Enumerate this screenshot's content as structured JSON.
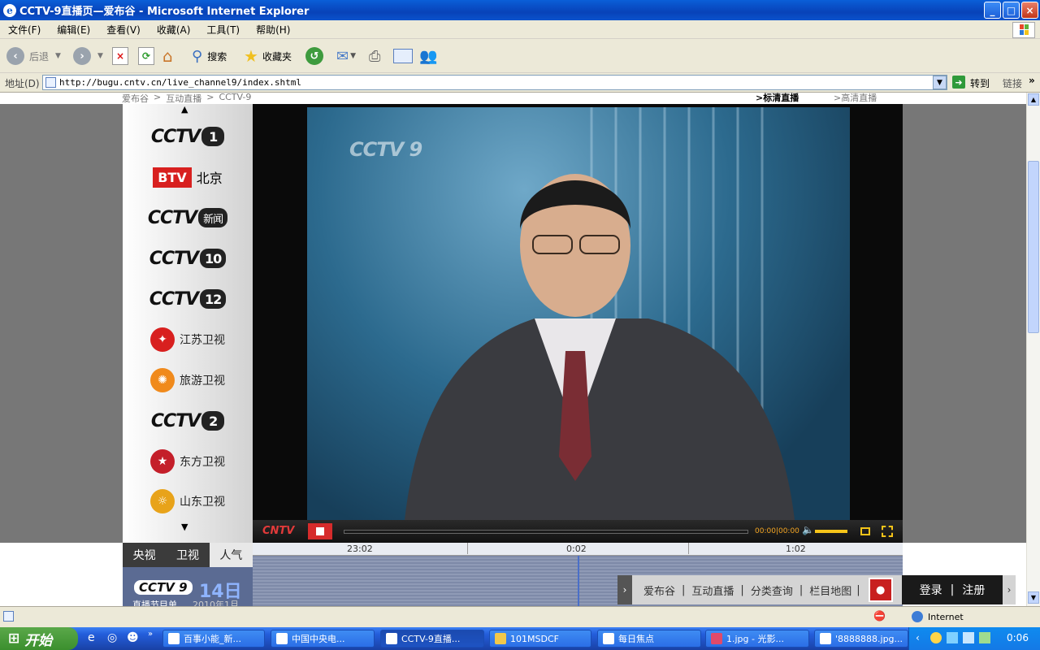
{
  "window": {
    "title": "CCTV-9直播页—爱布谷 - Microsoft Internet Explorer",
    "minimize": "_",
    "maximize": "□",
    "close": "×"
  },
  "menu": [
    "文件(F)",
    "编辑(E)",
    "查看(V)",
    "收藏(A)",
    "工具(T)",
    "帮助(H)"
  ],
  "toolbar": {
    "back": "后退",
    "search": "搜索",
    "favorites": "收藏夹"
  },
  "address": {
    "label": "地址(D)",
    "url": "http://bugu.cntv.cn/live_channel9/index.shtml",
    "go": "转到",
    "links": "链接"
  },
  "breadcrumb": {
    "items": [
      "爱布谷",
      "互动直播",
      "CCTV-9"
    ],
    "sep": ">",
    "sd": ">标清直播",
    "hd": ">高清直播"
  },
  "channels": [
    {
      "logo": "CCTV",
      "num": "1"
    },
    {
      "logo": "BTV",
      "name": "北京"
    },
    {
      "logo": "CCTV",
      "num": "新闻"
    },
    {
      "logo": "CCTV",
      "num": "10"
    },
    {
      "logo": "CCTV",
      "num": "12"
    },
    {
      "name": "江苏卫视"
    },
    {
      "name": "旅游卫视"
    },
    {
      "logo": "CCTV",
      "num": "2"
    },
    {
      "name": "东方卫视"
    },
    {
      "name": "山东卫视"
    }
  ],
  "video": {
    "watermark": "CCTV 9",
    "brand": "CNTV",
    "time": "00:00|00:00",
    "timeline": [
      "23:02",
      "0:02",
      "1:02"
    ]
  },
  "tabs": [
    "央视",
    "卫视",
    "人气"
  ],
  "epg": {
    "logo": "CCTV 9",
    "day": "14日",
    "caption": "直播节目单",
    "year": "2010年1月"
  },
  "bottomnav": {
    "links": [
      "爱布谷",
      "互动直播",
      "分类查询",
      "栏目地图"
    ],
    "login": "登录",
    "register": "注册"
  },
  "status": {
    "zone": "Internet"
  },
  "taskbar": {
    "start": "开始",
    "tasks": [
      "百事小能_新...",
      "中国中央电...",
      "CCTV-9直播...",
      "101MSDCF",
      "每日焦点",
      "1.jpg - 光影...",
      "'8888888.jpg..."
    ],
    "clock": "0:06"
  },
  "colors": {
    "titlebar": "#0842b8",
    "chrome": "#ece9d8",
    "video_bg": "#0a0a0a",
    "stop_button": "#d62b2b",
    "cntv_red": "#e23a3a"
  }
}
